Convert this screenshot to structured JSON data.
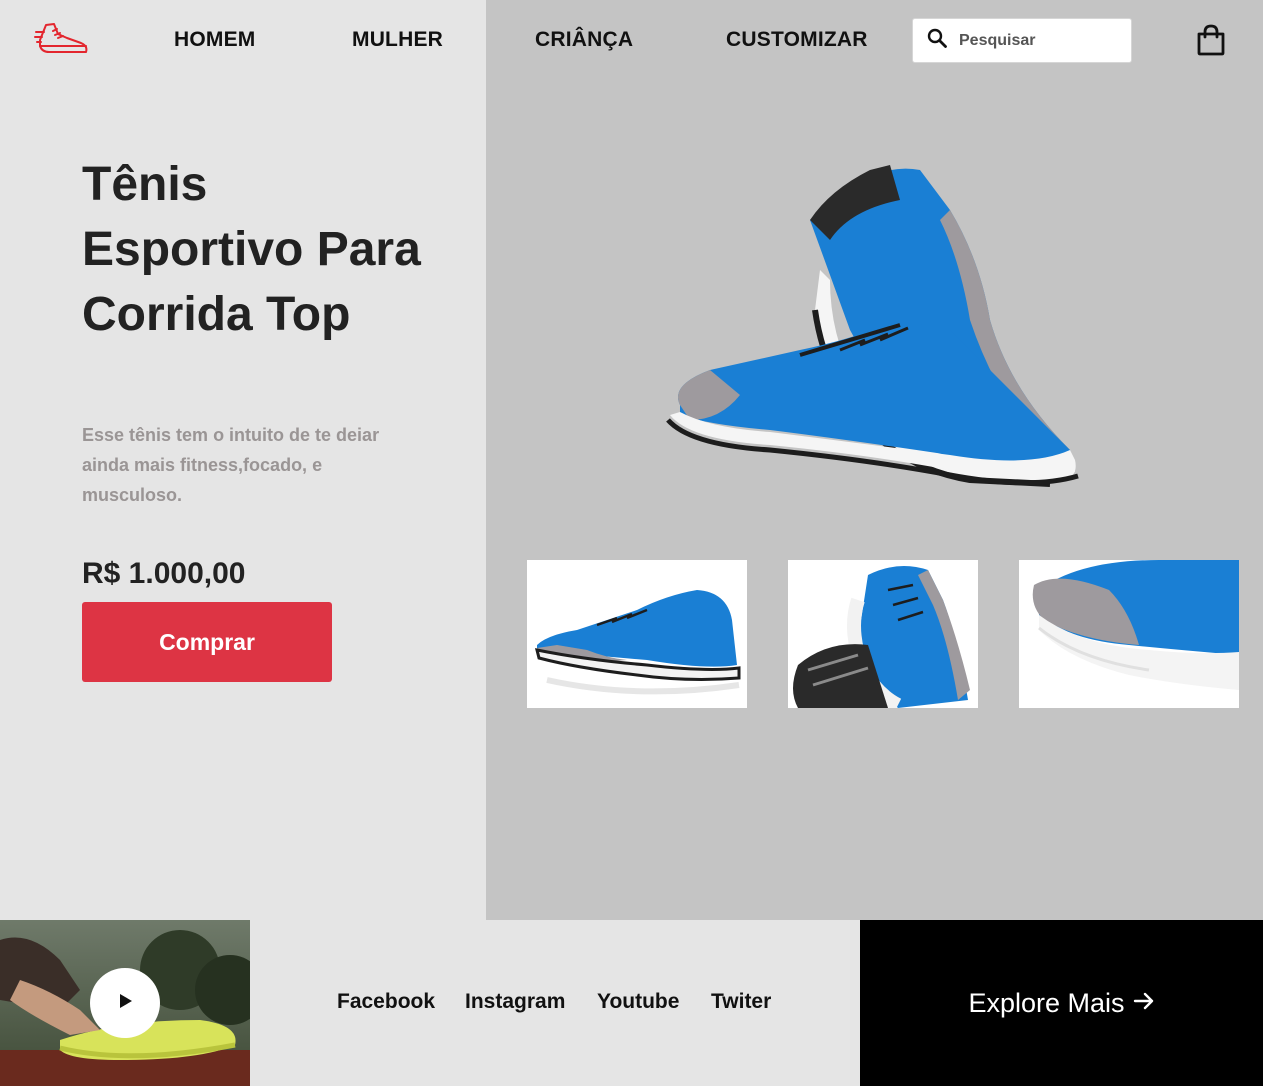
{
  "nav": {
    "logo_icon": "running-shoe-icon",
    "items": [
      "HOMEM",
      "MULHER",
      "CRIÂNÇA",
      "CUSTOMIZAR"
    ],
    "search_placeholder": "Pesquisar",
    "cart_icon": "shopping-bag-icon"
  },
  "hero": {
    "title": "Tênis Esportivo Para Corrida Top",
    "description": "Esse tênis tem o intuito de te deiar ainda mais fitness,focado, e musculoso.",
    "price": "R$ 1.000,00",
    "buy_label": "Comprar"
  },
  "footer": {
    "play_icon": "play-icon",
    "socials": [
      "Facebook",
      "Instagram",
      "Youtube",
      "Twiter"
    ],
    "explore_label": "Explore Mais",
    "explore_icon": "arrow-right-icon"
  },
  "colors": {
    "accent": "#dd3444",
    "shoe_blue": "#1a7fd4",
    "left_bg": "#e5e5e5",
    "right_bg": "#c4c4c4",
    "footer_dark": "#000000"
  }
}
